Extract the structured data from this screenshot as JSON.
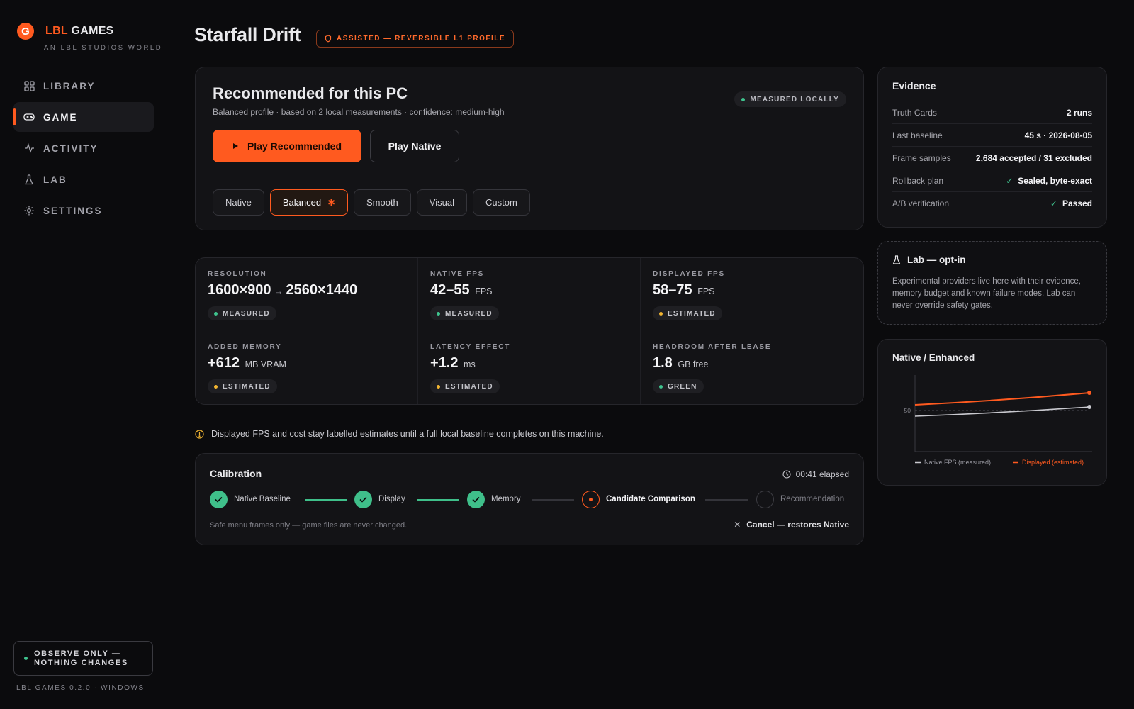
{
  "brand": {
    "logo_letter": "G",
    "name_accent": "LBL",
    "name_rest": " GAMES",
    "subtitle": "AN LBL STUDIOS WORLD"
  },
  "nav": {
    "items": [
      {
        "label": "LIBRARY",
        "icon": "grid-icon"
      },
      {
        "label": "GAME",
        "icon": "gamepad-icon",
        "active": true
      },
      {
        "label": "ACTIVITY",
        "icon": "activity-icon"
      },
      {
        "label": "LAB",
        "icon": "flask-icon"
      },
      {
        "label": "SETTINGS",
        "icon": "gear-icon"
      }
    ]
  },
  "observe": {
    "label": "OBSERVE ONLY — NOTHING CHANGES"
  },
  "version": "LBL GAMES 0.2.0 · WINDOWS",
  "header": {
    "title": "Starfall Drift",
    "badge": "ASSISTED — REVERSIBLE L1 PROFILE"
  },
  "recommended": {
    "title": "Recommended for this PC",
    "subtitle": "Balanced profile · based on 2 local measurements · confidence: medium-high",
    "status": "MEASURED LOCALLY",
    "play_recommended": "Play Recommended",
    "play_native": "Play Native",
    "presets": [
      "Native",
      "Balanced",
      "Smooth",
      "Visual",
      "Custom"
    ],
    "active_preset": "Balanced",
    "active_marker": "✱"
  },
  "evidence": {
    "title": "Evidence",
    "rows": [
      {
        "label": "Truth Cards",
        "value": "2 runs"
      },
      {
        "label": "Last baseline",
        "value": "45 s · 2026-08-05"
      },
      {
        "label": "Frame samples",
        "value": "2,684 accepted / 31 excluded"
      },
      {
        "label": "Rollback plan",
        "value": "Sealed, byte-exact",
        "check": true
      },
      {
        "label": "A/B verification",
        "value": "Passed",
        "check": true
      }
    ]
  },
  "metrics": {
    "resolution": {
      "label": "RESOLUTION",
      "from": "1600×900",
      "arrow": "→",
      "to": "2560×1440",
      "tag": "MEASURED"
    },
    "native_fps": {
      "label": "NATIVE FPS",
      "value": "42–55",
      "unit": "FPS",
      "tag": "MEASURED"
    },
    "displayed_fps": {
      "label": "DISPLAYED FPS",
      "value": "58–75",
      "unit": "FPS",
      "tag": "ESTIMATED"
    },
    "added_memory": {
      "label": "ADDED MEMORY",
      "value": "+612",
      "unit": "MB VRAM",
      "tag": "ESTIMATED"
    },
    "latency": {
      "label": "LATENCY EFFECT",
      "value": "+1.2",
      "unit": "ms",
      "tag": "ESTIMATED"
    },
    "headroom": {
      "label": "HEADROOM AFTER LEASE",
      "value": "1.8",
      "unit": "GB free",
      "tag": "GREEN"
    }
  },
  "note": "Displayed FPS and cost stay labelled estimates until a full local baseline completes on this machine.",
  "calibration": {
    "title": "Calibration",
    "elapsed": "00:41 elapsed",
    "steps": [
      {
        "label": "Native Baseline",
        "state": "done"
      },
      {
        "label": "Display",
        "state": "done"
      },
      {
        "label": "Memory",
        "state": "done"
      },
      {
        "label": "Candidate Comparison",
        "state": "current"
      },
      {
        "label": "Recommendation",
        "state": "todo"
      }
    ],
    "footnote": "Safe menu frames only — game files are never changed.",
    "cancel": "Cancel — restores Native"
  },
  "lab": {
    "title": "Lab — opt-in",
    "body": "Experimental providers live here with their evidence, memory budget and known failure modes. Lab can never override safety gates."
  },
  "colors": {
    "accent": "#ff5a1f",
    "green": "#3fc38e",
    "amber": "#f2b531",
    "native_line": "#c9c9cf"
  },
  "chart_data": {
    "type": "line",
    "title": "Native / Enhanced",
    "x": [
      0,
      1
    ],
    "series": [
      {
        "name": "Native FPS (measured)",
        "values": [
          42,
          55
        ]
      },
      {
        "name": "Displayed (estimated)",
        "values": [
          58,
          75
        ]
      }
    ],
    "yticks": [
      50
    ],
    "ylim": [
      0,
      100
    ],
    "reference_line": 50,
    "grid": false,
    "legend": "bottom"
  }
}
